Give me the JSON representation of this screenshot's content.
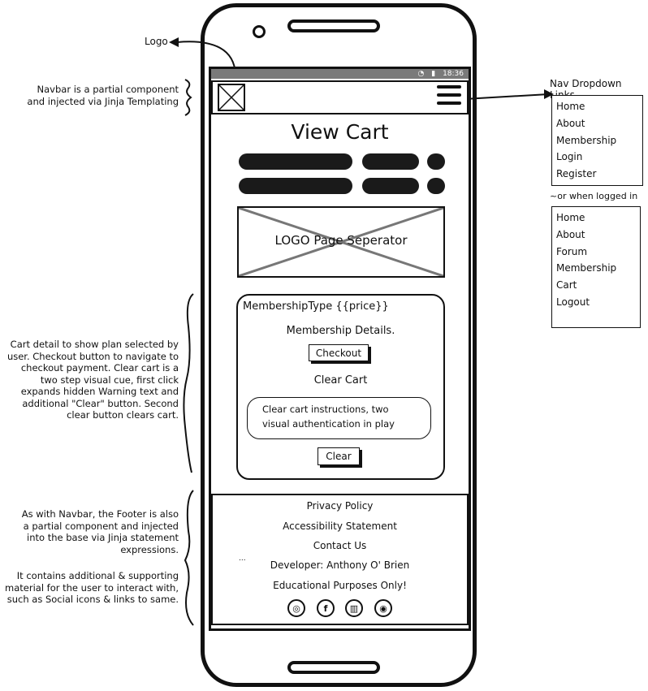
{
  "annotations": {
    "logo": "Logo",
    "navbar": [
      "Navbar is a partial component",
      "and injected via Jinja Templating"
    ],
    "cart": [
      "Cart detail to show plan selected by",
      "user. Checkout button to navigate to",
      "checkout payment. Clear cart is a",
      "two step visual cue, first click",
      "expands hidden Warning text and",
      "additional \"Clear\" button. Second",
      "clear button clears cart."
    ],
    "footer": [
      "As with Navbar, the Footer is also",
      "a partial component and injected",
      "into the base via Jinja statement",
      "expressions."
    ],
    "footer_extra": [
      "It contains additional & supporting",
      "material for the user to interact with,",
      "such as Social icons & links to same."
    ],
    "nav_dropdown_title": "Nav Dropdown Links",
    "logged_in_note": "~or when logged in"
  },
  "status_bar": {
    "time": "18:36"
  },
  "page": {
    "title": "View Cart",
    "separator_label": "LOGO Page Seperator"
  },
  "cart_card": {
    "heading": "MembershipType {{price}}",
    "details": "Membership Details.",
    "checkout_label": "Checkout",
    "clear_heading": "Clear Cart",
    "instructions_line1": "Clear cart instructions, two",
    "instructions_line2": "visual authentication in play",
    "clear_label": "Clear"
  },
  "footer": {
    "links": [
      "Privacy Policy",
      "Accessibility Statement",
      "Contact Us",
      "Developer: Anthony O' Brien",
      "Educational Purposes Only!"
    ],
    "ellipsis": "...",
    "social_icons": [
      "instagram-icon",
      "facebook-icon",
      "map-icon",
      "github-icon"
    ]
  },
  "nav_menu": {
    "default": [
      "Home",
      "About",
      "Membership",
      "Login",
      "Register"
    ],
    "logged_in": [
      "Home",
      "About",
      "Forum",
      "Membership",
      "Cart",
      "Logout"
    ]
  }
}
